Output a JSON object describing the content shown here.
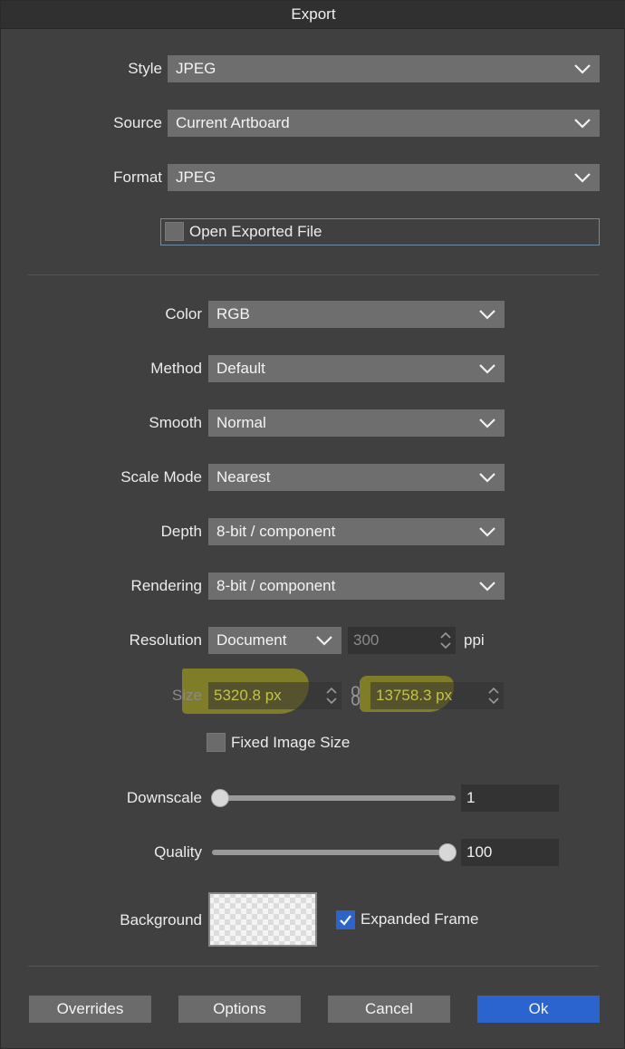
{
  "window": {
    "title": "Export"
  },
  "general": {
    "style": {
      "label": "Style",
      "value": "JPEG"
    },
    "source": {
      "label": "Source",
      "value": "Current Artboard"
    },
    "format": {
      "label": "Format",
      "value": "JPEG"
    },
    "open_exported_file": {
      "label": "Open Exported File",
      "checked": false
    }
  },
  "settings": {
    "color": {
      "label": "Color",
      "value": "RGB"
    },
    "method": {
      "label": "Method",
      "value": "Default"
    },
    "smooth": {
      "label": "Smooth",
      "value": "Normal"
    },
    "scale_mode": {
      "label": "Scale Mode",
      "value": "Nearest"
    },
    "depth": {
      "label": "Depth",
      "value": "8-bit / component"
    },
    "rendering": {
      "label": "Rendering",
      "value": "8-bit / component"
    },
    "resolution": {
      "label": "Resolution",
      "mode": "Document",
      "value": "300",
      "unit": "ppi"
    },
    "size": {
      "label": "Size",
      "width": "5320.8 px",
      "height": "13758.3 px"
    },
    "fixed_image_size": {
      "label": "Fixed Image Size",
      "checked": false
    },
    "downscale": {
      "label": "Downscale",
      "value": "1",
      "level": 0.0
    },
    "quality": {
      "label": "Quality",
      "value": "100",
      "level": 1.0
    },
    "background": {
      "label": "Background"
    },
    "expanded_frame": {
      "label": "Expanded Frame",
      "checked": true
    }
  },
  "buttons": {
    "overrides": "Overrides",
    "options": "Options",
    "cancel": "Cancel",
    "ok": "Ok"
  },
  "colors": {
    "dialog_bg": "#404040",
    "dropdown_bg": "#6e6e6e",
    "field_bg": "#333333",
    "primary_button": "#2c64cf",
    "annotation_highlight": "#b4af14",
    "disabled_text": "#8a8a8a"
  }
}
